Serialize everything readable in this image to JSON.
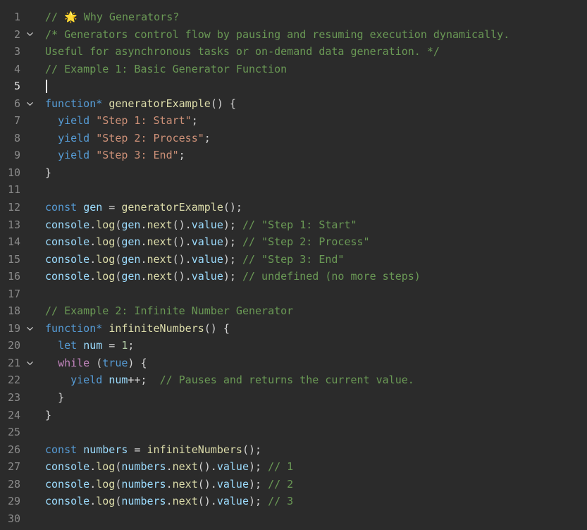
{
  "editor": {
    "active_line": 5,
    "colors": {
      "background": "#2b2b2b",
      "comment": "#6a9955",
      "keyword": "#569cd6",
      "control": "#c586c0",
      "string": "#ce9178",
      "function": "#dcdcaa",
      "variable": "#9cdcfe",
      "number": "#b5cea8",
      "punctuation": "#d4d4d4",
      "line_number": "#8a8a8a"
    },
    "lines": [
      {
        "n": "1",
        "fold": false,
        "tokens": [
          [
            "comment",
            "// "
          ],
          [
            "emoji",
            "🌟"
          ],
          [
            "comment",
            " Why Generators?"
          ]
        ]
      },
      {
        "n": "2",
        "fold": true,
        "tokens": [
          [
            "comment",
            "/* Generators control flow by pausing and resuming execution dynamically."
          ]
        ]
      },
      {
        "n": "3",
        "fold": false,
        "tokens": [
          [
            "comment",
            "Useful for asynchronous tasks or on-demand data generation. */"
          ]
        ]
      },
      {
        "n": "4",
        "fold": false,
        "tokens": [
          [
            "comment",
            "// Example 1: Basic Generator Function"
          ]
        ]
      },
      {
        "n": "5",
        "fold": false,
        "cursor": true,
        "tokens": []
      },
      {
        "n": "6",
        "fold": true,
        "tokens": [
          [
            "kw",
            "function*"
          ],
          [
            "plain",
            " "
          ],
          [
            "fn",
            "generatorExample"
          ],
          [
            "punc",
            "() {"
          ]
        ]
      },
      {
        "n": "7",
        "fold": false,
        "tokens": [
          [
            "plain",
            "  "
          ],
          [
            "kw",
            "yield"
          ],
          [
            "plain",
            " "
          ],
          [
            "str",
            "\"Step 1: Start\""
          ],
          [
            "punc",
            ";"
          ]
        ]
      },
      {
        "n": "8",
        "fold": false,
        "tokens": [
          [
            "plain",
            "  "
          ],
          [
            "kw",
            "yield"
          ],
          [
            "plain",
            " "
          ],
          [
            "str",
            "\"Step 2: Process\""
          ],
          [
            "punc",
            ";"
          ]
        ]
      },
      {
        "n": "9",
        "fold": false,
        "tokens": [
          [
            "plain",
            "  "
          ],
          [
            "kw",
            "yield"
          ],
          [
            "plain",
            " "
          ],
          [
            "str",
            "\"Step 3: End\""
          ],
          [
            "punc",
            ";"
          ]
        ]
      },
      {
        "n": "10",
        "fold": false,
        "tokens": [
          [
            "punc",
            "}"
          ]
        ]
      },
      {
        "n": "11",
        "fold": false,
        "tokens": []
      },
      {
        "n": "12",
        "fold": false,
        "tokens": [
          [
            "kw",
            "const"
          ],
          [
            "plain",
            " "
          ],
          [
            "var",
            "gen"
          ],
          [
            "punc",
            " = "
          ],
          [
            "fn",
            "generatorExample"
          ],
          [
            "punc",
            "();"
          ]
        ]
      },
      {
        "n": "13",
        "fold": false,
        "tokens": [
          [
            "var",
            "console"
          ],
          [
            "punc",
            "."
          ],
          [
            "fn",
            "log"
          ],
          [
            "punc",
            "("
          ],
          [
            "var",
            "gen"
          ],
          [
            "punc",
            "."
          ],
          [
            "fn",
            "next"
          ],
          [
            "punc",
            "()."
          ],
          [
            "var",
            "value"
          ],
          [
            "punc",
            "); "
          ],
          [
            "comment",
            "// \"Step 1: Start\""
          ]
        ]
      },
      {
        "n": "14",
        "fold": false,
        "tokens": [
          [
            "var",
            "console"
          ],
          [
            "punc",
            "."
          ],
          [
            "fn",
            "log"
          ],
          [
            "punc",
            "("
          ],
          [
            "var",
            "gen"
          ],
          [
            "punc",
            "."
          ],
          [
            "fn",
            "next"
          ],
          [
            "punc",
            "()."
          ],
          [
            "var",
            "value"
          ],
          [
            "punc",
            "); "
          ],
          [
            "comment",
            "// \"Step 2: Process\""
          ]
        ]
      },
      {
        "n": "15",
        "fold": false,
        "tokens": [
          [
            "var",
            "console"
          ],
          [
            "punc",
            "."
          ],
          [
            "fn",
            "log"
          ],
          [
            "punc",
            "("
          ],
          [
            "var",
            "gen"
          ],
          [
            "punc",
            "."
          ],
          [
            "fn",
            "next"
          ],
          [
            "punc",
            "()."
          ],
          [
            "var",
            "value"
          ],
          [
            "punc",
            "); "
          ],
          [
            "comment",
            "// \"Step 3: End\""
          ]
        ]
      },
      {
        "n": "16",
        "fold": false,
        "tokens": [
          [
            "var",
            "console"
          ],
          [
            "punc",
            "."
          ],
          [
            "fn",
            "log"
          ],
          [
            "punc",
            "("
          ],
          [
            "var",
            "gen"
          ],
          [
            "punc",
            "."
          ],
          [
            "fn",
            "next"
          ],
          [
            "punc",
            "()."
          ],
          [
            "var",
            "value"
          ],
          [
            "punc",
            "); "
          ],
          [
            "comment",
            "// undefined (no more steps)"
          ]
        ]
      },
      {
        "n": "17",
        "fold": false,
        "tokens": []
      },
      {
        "n": "18",
        "fold": false,
        "tokens": [
          [
            "comment",
            "// Example 2: Infinite Number Generator"
          ]
        ]
      },
      {
        "n": "19",
        "fold": true,
        "tokens": [
          [
            "kw",
            "function*"
          ],
          [
            "plain",
            " "
          ],
          [
            "fn",
            "infiniteNumbers"
          ],
          [
            "punc",
            "() {"
          ]
        ]
      },
      {
        "n": "20",
        "fold": false,
        "tokens": [
          [
            "plain",
            "  "
          ],
          [
            "kw",
            "let"
          ],
          [
            "plain",
            " "
          ],
          [
            "var",
            "num"
          ],
          [
            "punc",
            " = "
          ],
          [
            "num",
            "1"
          ],
          [
            "punc",
            ";"
          ]
        ]
      },
      {
        "n": "21",
        "fold": true,
        "tokens": [
          [
            "plain",
            "  "
          ],
          [
            "ctrl",
            "while"
          ],
          [
            "punc",
            " ("
          ],
          [
            "kw",
            "true"
          ],
          [
            "punc",
            ") {"
          ]
        ]
      },
      {
        "n": "22",
        "fold": false,
        "tokens": [
          [
            "plain",
            "    "
          ],
          [
            "kw",
            "yield"
          ],
          [
            "plain",
            " "
          ],
          [
            "var",
            "num"
          ],
          [
            "punc",
            "++;  "
          ],
          [
            "comment",
            "// Pauses and returns the current value."
          ]
        ]
      },
      {
        "n": "23",
        "fold": false,
        "tokens": [
          [
            "plain",
            "  "
          ],
          [
            "punc",
            "}"
          ]
        ]
      },
      {
        "n": "24",
        "fold": false,
        "tokens": [
          [
            "punc",
            "}"
          ]
        ]
      },
      {
        "n": "25",
        "fold": false,
        "tokens": []
      },
      {
        "n": "26",
        "fold": false,
        "tokens": [
          [
            "kw",
            "const"
          ],
          [
            "plain",
            " "
          ],
          [
            "var",
            "numbers"
          ],
          [
            "punc",
            " = "
          ],
          [
            "fn",
            "infiniteNumbers"
          ],
          [
            "punc",
            "();"
          ]
        ]
      },
      {
        "n": "27",
        "fold": false,
        "tokens": [
          [
            "var",
            "console"
          ],
          [
            "punc",
            "."
          ],
          [
            "fn",
            "log"
          ],
          [
            "punc",
            "("
          ],
          [
            "var",
            "numbers"
          ],
          [
            "punc",
            "."
          ],
          [
            "fn",
            "next"
          ],
          [
            "punc",
            "()."
          ],
          [
            "var",
            "value"
          ],
          [
            "punc",
            "); "
          ],
          [
            "comment",
            "// 1"
          ]
        ]
      },
      {
        "n": "28",
        "fold": false,
        "tokens": [
          [
            "var",
            "console"
          ],
          [
            "punc",
            "."
          ],
          [
            "fn",
            "log"
          ],
          [
            "punc",
            "("
          ],
          [
            "var",
            "numbers"
          ],
          [
            "punc",
            "."
          ],
          [
            "fn",
            "next"
          ],
          [
            "punc",
            "()."
          ],
          [
            "var",
            "value"
          ],
          [
            "punc",
            "); "
          ],
          [
            "comment",
            "// 2"
          ]
        ]
      },
      {
        "n": "29",
        "fold": false,
        "tokens": [
          [
            "var",
            "console"
          ],
          [
            "punc",
            "."
          ],
          [
            "fn",
            "log"
          ],
          [
            "punc",
            "("
          ],
          [
            "var",
            "numbers"
          ],
          [
            "punc",
            "."
          ],
          [
            "fn",
            "next"
          ],
          [
            "punc",
            "()."
          ],
          [
            "var",
            "value"
          ],
          [
            "punc",
            "); "
          ],
          [
            "comment",
            "// 3"
          ]
        ]
      },
      {
        "n": "30",
        "fold": false,
        "tokens": []
      }
    ]
  }
}
